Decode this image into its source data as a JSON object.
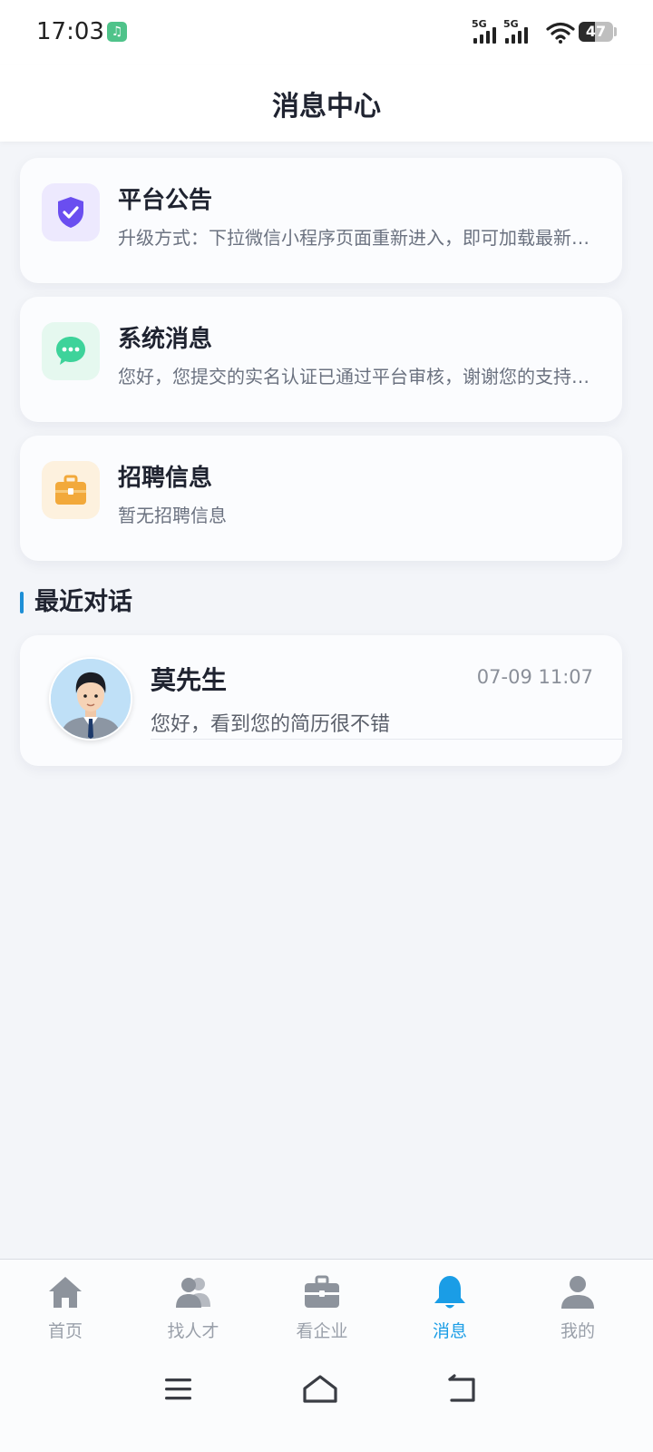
{
  "status_bar": {
    "time": "17:03",
    "app_badge": "♫",
    "signal_1_label": "5G",
    "signal_2_label": "5G",
    "battery": "47",
    "battery_level_percent": 47
  },
  "header": {
    "title": "消息中心"
  },
  "notices": [
    {
      "title": "平台公告",
      "desc": "升级方式：下拉微信小程序页面重新进入，即可加载最新版本",
      "icon": "shield-check-icon",
      "icon_color": "#6a4ef0",
      "bg_color": "#ede9fe"
    },
    {
      "title": "系统消息",
      "desc": "您好，您提交的实名认证已通过平台审核，谢谢您的支持与配合",
      "icon": "chat-bubble-icon",
      "icon_color": "#3dd39a",
      "bg_color": "#e5f8ef"
    },
    {
      "title": "招聘信息",
      "desc": "暂无招聘信息",
      "icon": "briefcase-icon",
      "icon_color": "#f2a93b",
      "bg_color": "#fdf1de"
    }
  ],
  "recent": {
    "section_title": "最近对话",
    "conversations": [
      {
        "name": "莫先生",
        "time": "07-09 11:07",
        "message": "您好，看到您的简历很不错"
      }
    ]
  },
  "tabbar": {
    "active_color": "#1a9de6",
    "inactive_color": "#9aa0aa",
    "items": [
      {
        "label": "首页",
        "icon": "home-icon"
      },
      {
        "label": "找人才",
        "icon": "people-icon"
      },
      {
        "label": "看企业",
        "icon": "briefcase-icon"
      },
      {
        "label": "消息",
        "icon": "bell-icon",
        "active": true
      },
      {
        "label": "我的",
        "icon": "user-icon"
      }
    ]
  }
}
